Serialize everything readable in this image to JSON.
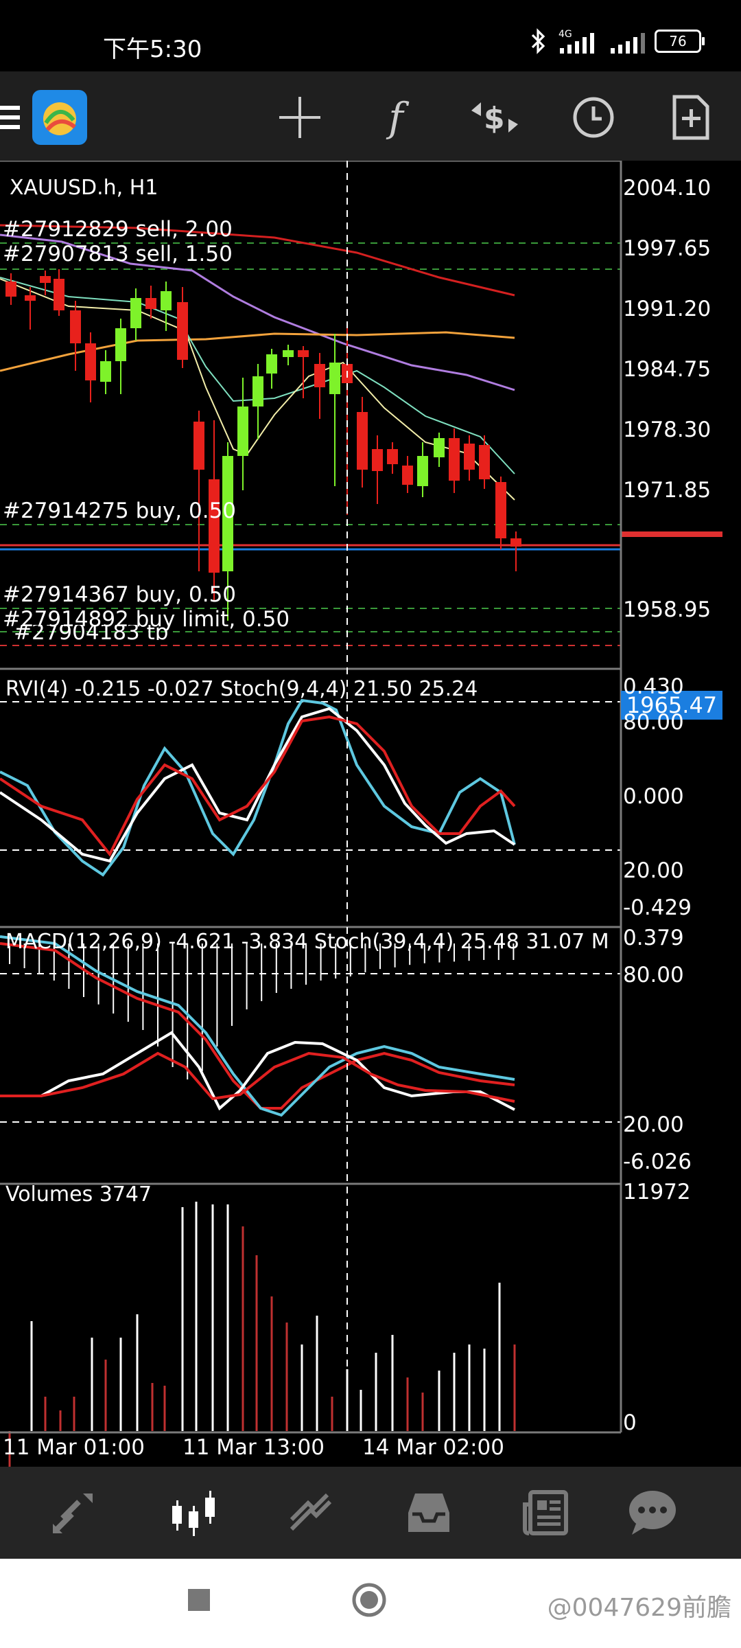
{
  "status_bar": {
    "time": "下午5:30",
    "battery": "76",
    "network": "4G"
  },
  "toolbar": {
    "icons": [
      "menu-icon",
      "mt-logo-icon",
      "crosshair-icon",
      "indicators-icon",
      "trade-icon",
      "timeframe-icon",
      "new-order-icon"
    ],
    "function_glyph": "f"
  },
  "chart": {
    "symbol_label": "XAUUSD.h, H1",
    "current_price": "1965.47",
    "price_axis": [
      "2004.10",
      "1997.65",
      "1991.20",
      "1984.75",
      "1978.30",
      "1971.85",
      "1958.95"
    ],
    "orders": [
      "#27912829 sell, 2.00",
      "#27907813 sell, 1.50",
      "#27914275 buy, 0.50",
      "#27914367 buy, 0.50",
      "#27914892 buy limit, 0.50",
      "#27904183 tp"
    ],
    "time_axis": [
      "11 Mar 01:00",
      "11 Mar 13:00",
      "14 Mar 02:00"
    ],
    "colors": {
      "bull": "#7ef22a",
      "bear": "#e8211c",
      "price_line": "#1b7ee0",
      "ma_red": "#d42020",
      "ma_purple": "#b07de0",
      "ma_orange": "#f2a23c",
      "ma_teal": "#7fe0c0",
      "ma_yellow": "#f3eeaa"
    }
  },
  "rvi_pane": {
    "label": "RVI(4) -0.215 -0.027 Stoch(9,4,4) 21.50 25.24",
    "axis": [
      "0.430",
      "80.00",
      "0.000",
      "20.00",
      "-0.429"
    ]
  },
  "macd_pane": {
    "label": "MACD(12,26,9) -4.621 -3.834 Stoch(39,4,4) 25.48 31.07 M",
    "axis": [
      "0.379",
      "80.00",
      "20.00",
      "-6.026"
    ]
  },
  "volume_pane": {
    "label": "Volumes 3747",
    "axis": [
      "11972",
      "0"
    ]
  },
  "bottom_nav": {
    "items": [
      "quotes-icon",
      "chart-icon",
      "trade-icon",
      "history-icon",
      "news-icon",
      "chat-icon"
    ]
  },
  "system_nav": {
    "items": [
      "recents-icon",
      "home-icon"
    ]
  },
  "watermark": "@0047629前膽"
}
